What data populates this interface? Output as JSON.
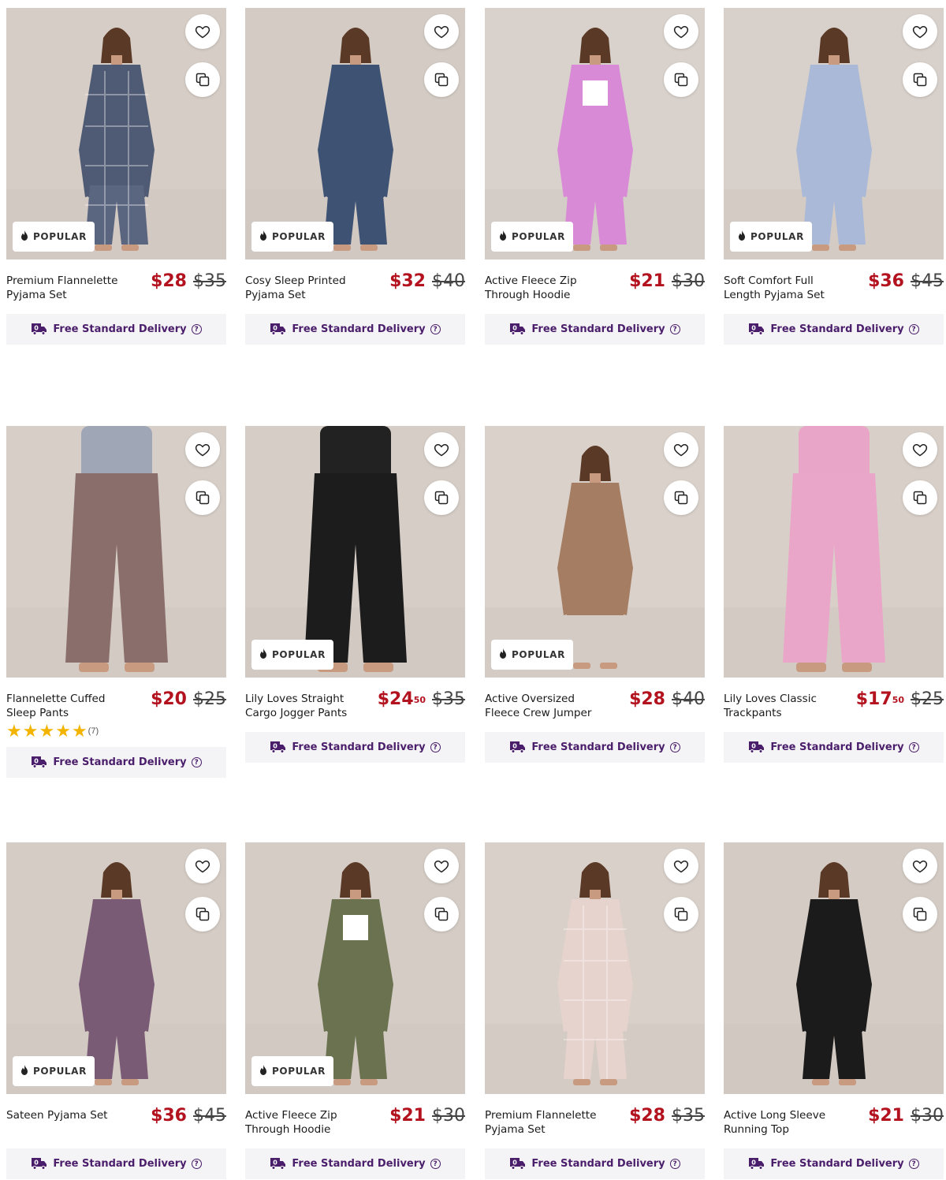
{
  "labels": {
    "popular": "POPULAR",
    "delivery": "Free Standard Delivery",
    "help": "?"
  },
  "products": [
    {
      "name": "Premium Flannelette Pyjama Set",
      "price": "$28",
      "price_cents": "",
      "was": "$35",
      "popular": true,
      "garment": "plaid",
      "top_color": "#4f5b74",
      "bottom_color": "#5a6580",
      "bg": "#d6cdc6"
    },
    {
      "name": "Cosy Sleep Printed Pyjama Set",
      "price": "$32",
      "price_cents": "",
      "was": "$40",
      "popular": true,
      "garment": "plain",
      "top_color": "#3e5374",
      "bottom_color": "#3e5374",
      "bg": "#d3cbc4"
    },
    {
      "name": "Active Fleece Zip Through Hoodie",
      "price": "$21",
      "price_cents": "",
      "was": "$30",
      "popular": true,
      "garment": "hoodie",
      "top_color": "#d98ad6",
      "bottom_color": "#d98ad6",
      "bg": "#d9d2cc"
    },
    {
      "name": "Soft Comfort Full Length Pyjama Set",
      "price": "$36",
      "price_cents": "",
      "was": "$45",
      "popular": true,
      "garment": "plain",
      "top_color": "#a9b9d7",
      "bottom_color": "#a9b9d7",
      "bg": "#d8d0ca"
    },
    {
      "name": "Flannelette Cuffed Sleep Pants",
      "price": "$20",
      "price_cents": "",
      "was": "$25",
      "popular": false,
      "garment": "pants",
      "top_color": "#9fa6b6",
      "bottom_color": "#8a6e6c",
      "bg": "#d6cec7",
      "rating_count": "(7)",
      "rating": 5
    },
    {
      "name": "Lily Loves Straight Cargo Jogger Pants",
      "price": "$24",
      "price_cents": "50",
      "was": "$35",
      "popular": true,
      "garment": "pants",
      "top_color": "#222222",
      "bottom_color": "#1c1c1c",
      "bg": "#d5cdc6"
    },
    {
      "name": "Active Oversized Fleece Crew Jumper",
      "price": "$28",
      "price_cents": "",
      "was": "$40",
      "popular": true,
      "garment": "jumper",
      "top_color": "#a57d63",
      "bottom_color": "#a57d63",
      "bg": "#d9d1ca"
    },
    {
      "name": "Lily Loves Classic Trackpants",
      "price": "$17",
      "price_cents": "50",
      "was": "$25",
      "popular": false,
      "garment": "pants",
      "top_color": "#e9a5c8",
      "bottom_color": "#eaa6c9",
      "bg": "#d8cfc8"
    },
    {
      "name": "Sateen Pyjama Set",
      "price": "$36",
      "price_cents": "",
      "was": "$45",
      "popular": true,
      "garment": "plain",
      "top_color": "#7a5b76",
      "bottom_color": "#7a5b76",
      "bg": "#d5ccc5"
    },
    {
      "name": "Active Fleece Zip Through Hoodie",
      "price": "$21",
      "price_cents": "",
      "was": "$30",
      "popular": true,
      "garment": "hoodie",
      "top_color": "#6b7250",
      "bottom_color": "#6b7250",
      "bg": "#d4ccc5"
    },
    {
      "name": "Premium Flannelette Pyjama Set",
      "price": "$28",
      "price_cents": "",
      "was": "$35",
      "popular": false,
      "garment": "plaid",
      "top_color": "#e7d3cd",
      "bottom_color": "#e7d3cd",
      "bg": "#d9d0ca"
    },
    {
      "name": "Active Long Sleeve Running Top",
      "price": "$21",
      "price_cents": "",
      "was": "$30",
      "popular": false,
      "garment": "plain",
      "top_color": "#1b1b1b",
      "bottom_color": "#1b1b1b",
      "bg": "#d3cbc4"
    }
  ],
  "colors": {
    "price": "#b3121f",
    "delivery": "#4a1e6b",
    "star": "#f3b400"
  }
}
